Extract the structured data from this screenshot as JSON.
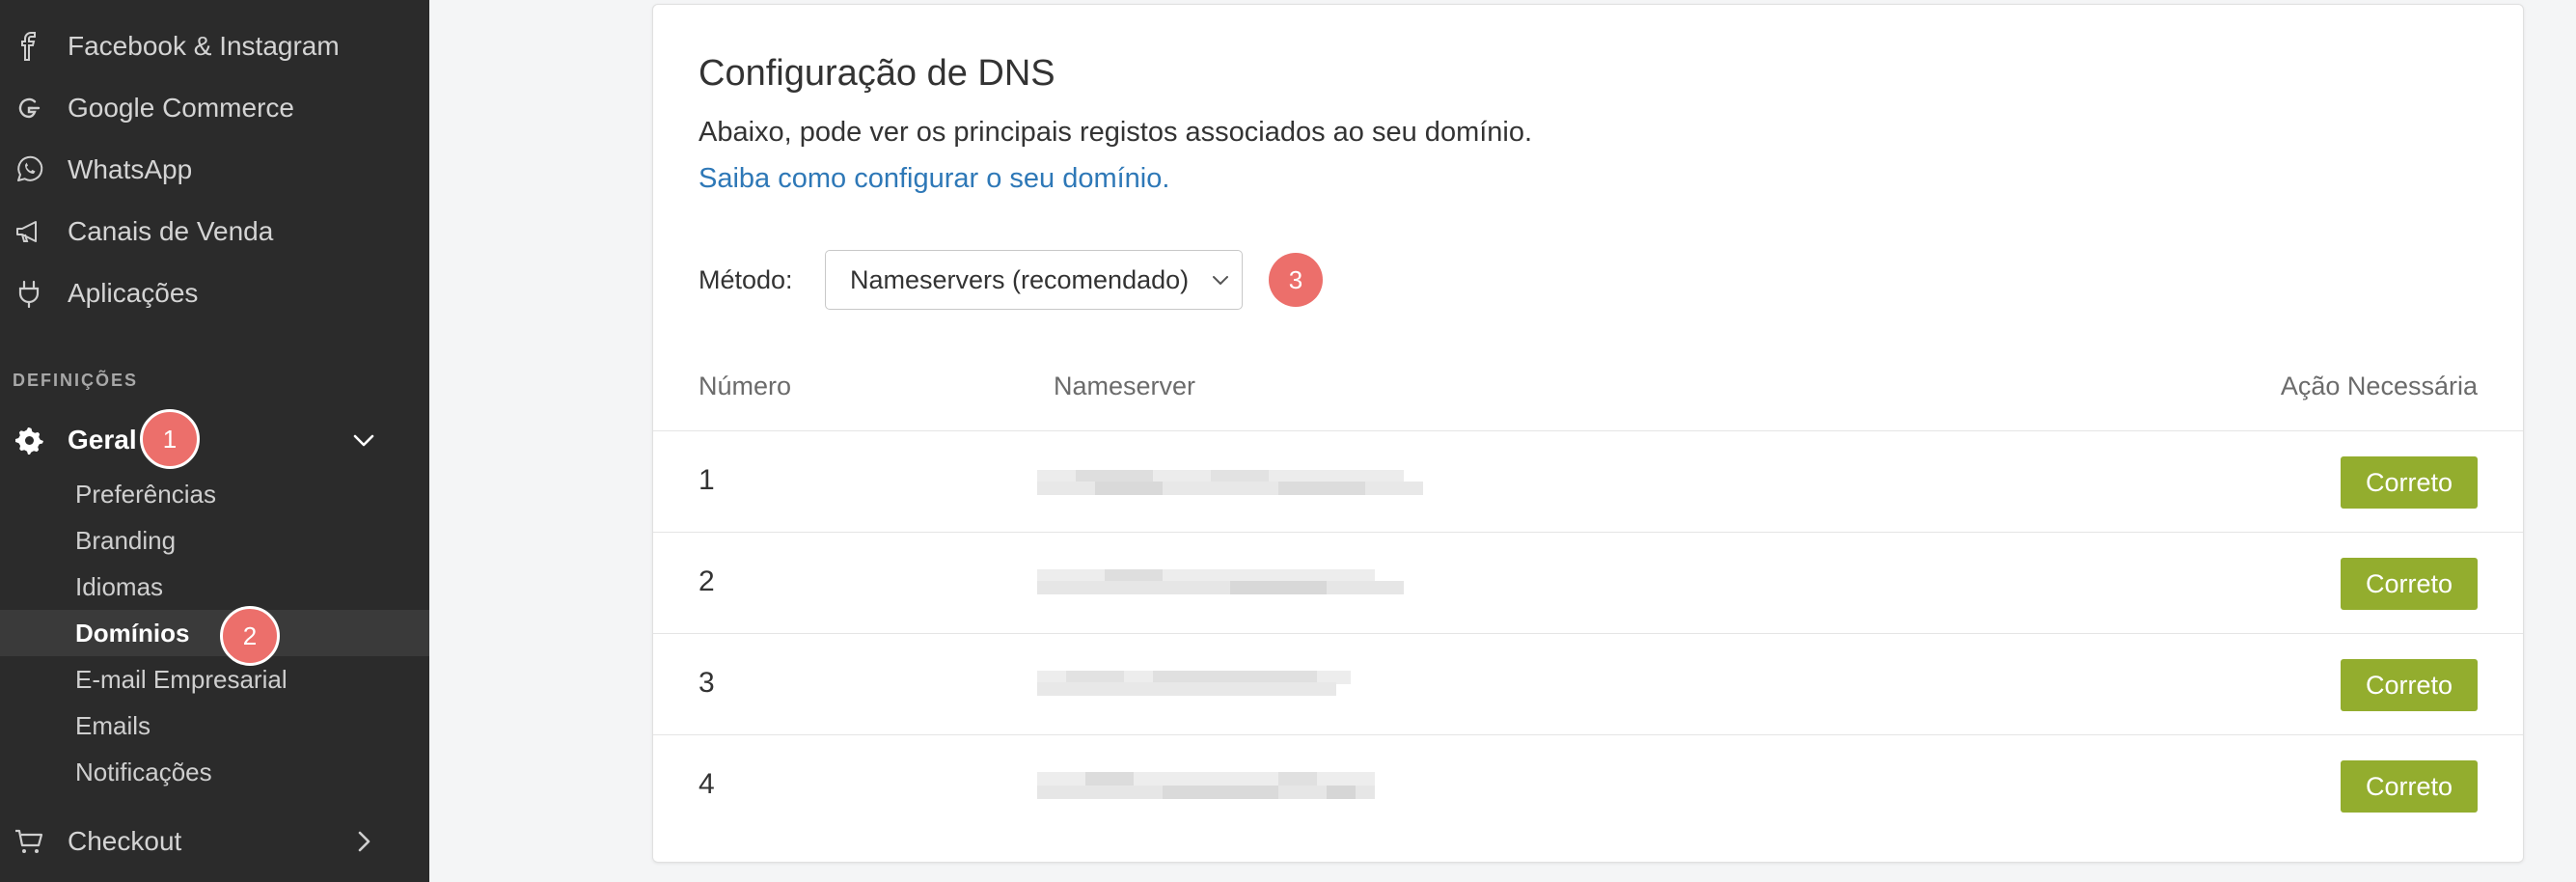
{
  "sidebar": {
    "items": [
      {
        "label": "Facebook & Instagram",
        "icon": "facebook-icon"
      },
      {
        "label": "Google Commerce",
        "icon": "google-icon"
      },
      {
        "label": "WhatsApp",
        "icon": "whatsapp-icon"
      },
      {
        "label": "Canais de Venda",
        "icon": "megaphone-icon"
      },
      {
        "label": "Aplicações",
        "icon": "plug-icon"
      }
    ],
    "section_label": "DEFINIÇÕES",
    "geral": {
      "label": "Geral",
      "icon": "gear-icon"
    },
    "sub_items": [
      {
        "label": "Preferências"
      },
      {
        "label": "Branding"
      },
      {
        "label": "Idiomas"
      },
      {
        "label": "Domínios",
        "active": true
      },
      {
        "label": "E-mail Empresarial"
      },
      {
        "label": "Emails"
      },
      {
        "label": "Notificações"
      }
    ],
    "checkout": {
      "label": "Checkout",
      "icon": "cart-icon"
    }
  },
  "badges": {
    "step1": "1",
    "step2": "2",
    "step3": "3"
  },
  "main": {
    "title": "Configuração de DNS",
    "description": "Abaixo, pode ver os principais registos associados ao seu domínio.",
    "link": "Saiba como configurar o seu domínio.",
    "method_label": "Método:",
    "method_value": "Nameservers (recomendado)",
    "table": {
      "headers": {
        "number": "Número",
        "nameserver": "Nameserver",
        "action": "Ação Necessária"
      },
      "rows": [
        {
          "number": "1",
          "action": "Correto"
        },
        {
          "number": "2",
          "action": "Correto"
        },
        {
          "number": "3",
          "action": "Correto"
        },
        {
          "number": "4",
          "action": "Correto"
        }
      ]
    }
  },
  "colors": {
    "accent_link": "#2e78b7",
    "ok_button": "#93ad2e",
    "badge": "#ec6f6b",
    "sidebar_bg": "#2b2b2b"
  }
}
